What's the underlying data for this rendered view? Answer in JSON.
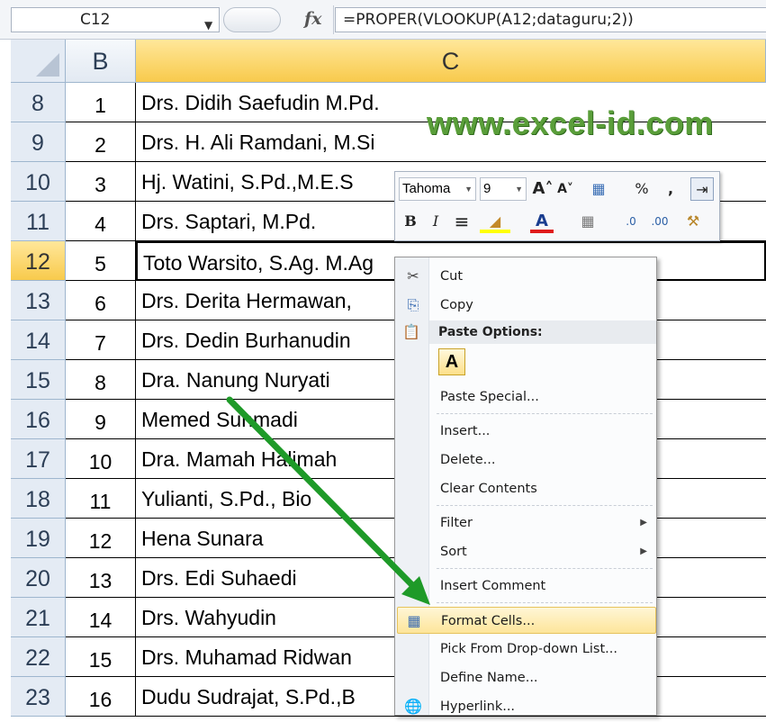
{
  "formula_bar": {
    "name_box": "C12",
    "fx_label": "fx",
    "formula": "=PROPER(VLOOKUP(A12;dataguru;2))"
  },
  "columns": [
    {
      "label": "B",
      "active": false
    },
    {
      "label": "C",
      "active": true
    }
  ],
  "rows": [
    {
      "row": "8",
      "b": "1",
      "c": "Drs. Didih Saefudin M.Pd."
    },
    {
      "row": "9",
      "b": "2",
      "c": "Drs. H. Ali Ramdani, M.Si"
    },
    {
      "row": "10",
      "b": "3",
      "c": "Hj. Watini, S.Pd.,M.E.S"
    },
    {
      "row": "11",
      "b": "4",
      "c": "Drs. Saptari, M.Pd."
    },
    {
      "row": "12",
      "b": "5",
      "c": "Toto Warsito, S.Ag. M.Ag",
      "active": true
    },
    {
      "row": "13",
      "b": "6",
      "c": "Drs. Derita Hermawan,"
    },
    {
      "row": "14",
      "b": "7",
      "c": "Drs. Dedin Burhanudin"
    },
    {
      "row": "15",
      "b": "8",
      "c": "Dra. Nanung Nuryati"
    },
    {
      "row": "16",
      "b": "9",
      "c": "Memed Suhmadi"
    },
    {
      "row": "17",
      "b": "10",
      "c": "Dra. Mamah Halimah"
    },
    {
      "row": "18",
      "b": "11",
      "c": "Yulianti, S.Pd., Bio"
    },
    {
      "row": "19",
      "b": "12",
      "c": "Hena Sunara"
    },
    {
      "row": "20",
      "b": "13",
      "c": "Drs. Edi Suhaedi"
    },
    {
      "row": "21",
      "b": "14",
      "c": "Drs. Wahyudin"
    },
    {
      "row": "22",
      "b": "15",
      "c": "Drs. Muhamad Ridwan"
    },
    {
      "row": "23",
      "b": "16",
      "c": "Dudu Sudrajat, S.Pd.,B"
    }
  ],
  "watermark": "www.excel-id.com",
  "mini_toolbar": {
    "font": "Tahoma",
    "size": "9",
    "buttons_row1": [
      "A˄",
      "A˅",
      "▦",
      "%",
      ",",
      "⇥"
    ],
    "buttons_row2": [
      "B",
      "I",
      "≡",
      "◢",
      "A",
      "▦",
      ".0",
      ".00",
      "⚒"
    ]
  },
  "context_menu": {
    "cut": "Cut",
    "copy": "Copy",
    "paste_options": "Paste Options:",
    "paste_a": "A",
    "paste_special": "Paste Special...",
    "insert": "Insert...",
    "delete": "Delete...",
    "clear_contents": "Clear Contents",
    "filter": "Filter",
    "sort": "Sort",
    "insert_comment": "Insert Comment",
    "format_cells": "Format Cells...",
    "pick_list": "Pick From Drop-down List...",
    "define_name": "Define Name...",
    "hyperlink": "Hyperlink..."
  },
  "colors": {
    "accent_selected": "#f8ca4c",
    "arrow": "#1e9a28",
    "watermark": "#5a9e3a"
  }
}
